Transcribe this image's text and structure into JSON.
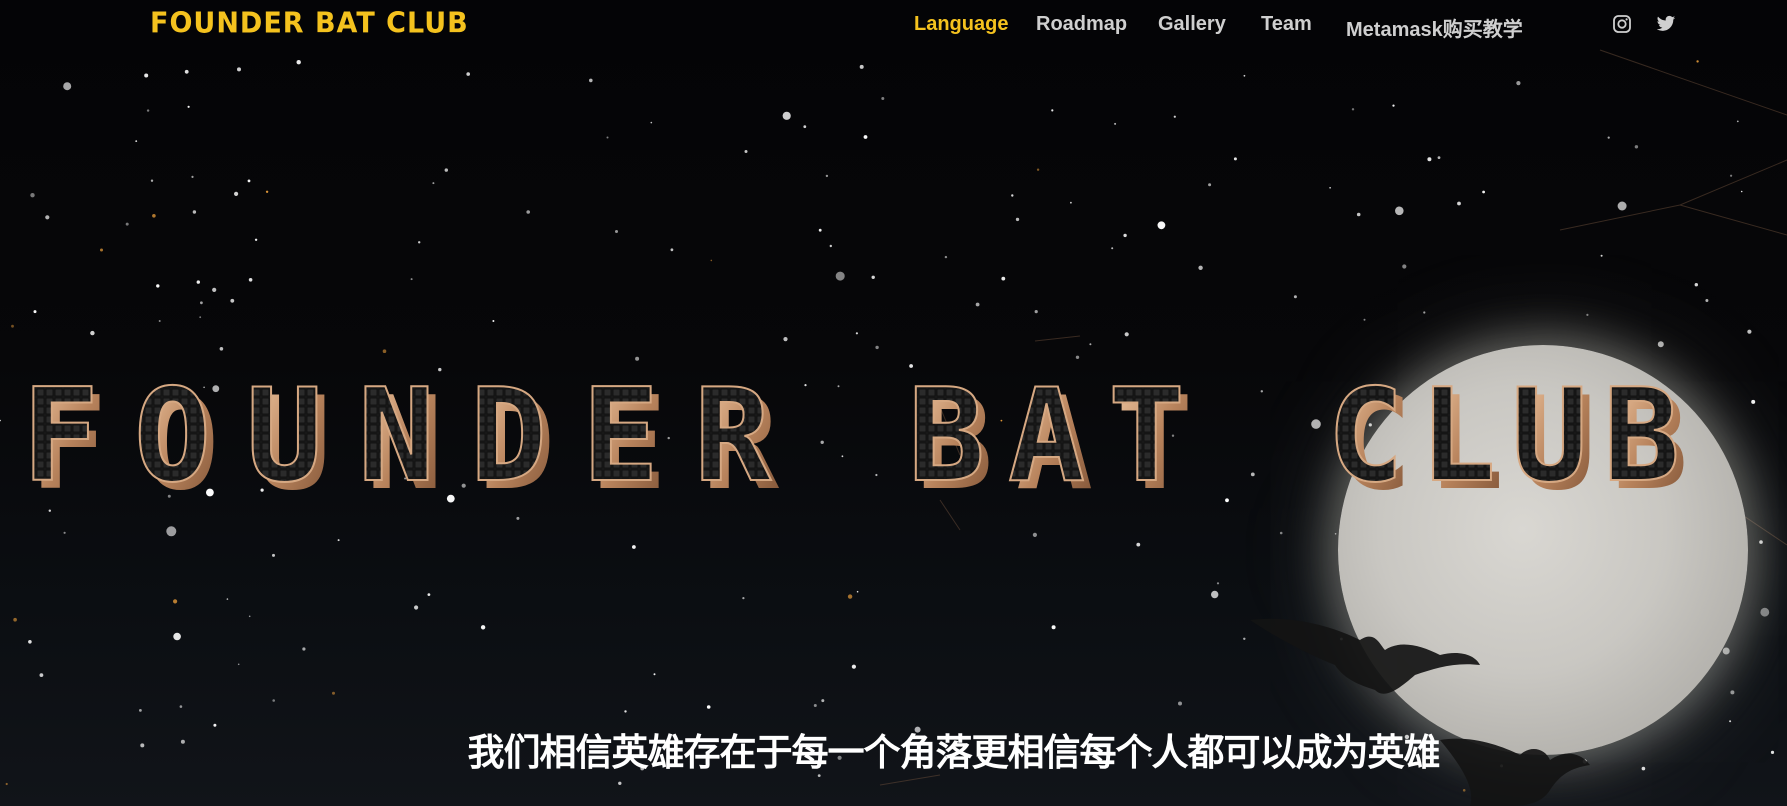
{
  "brand": {
    "name": "FOUNDER BAT CLUB"
  },
  "nav": {
    "items": [
      {
        "label": "Language",
        "active": true
      },
      {
        "label": "Roadmap",
        "active": false
      },
      {
        "label": "Gallery",
        "active": false
      },
      {
        "label": "Team",
        "active": false
      },
      {
        "label": "Metamask购买教学",
        "active": false
      }
    ],
    "social": [
      {
        "icon": "instagram-icon"
      },
      {
        "icon": "twitter-icon"
      }
    ]
  },
  "hero": {
    "title": "FOUNDER BAT CLUB",
    "words": [
      "FOUNDER",
      "BAT",
      "CLUB"
    ],
    "tagline": "我们相信英雄存在于每一个角落更相信每个人都可以成为英雄"
  },
  "colors": {
    "accent": "#f4c21e",
    "nav_text": "#cfcfcf",
    "title_face": "#1c1c1c",
    "title_bevel": "#c89a72",
    "moon": "#cfcdc8",
    "background": "#050507"
  }
}
